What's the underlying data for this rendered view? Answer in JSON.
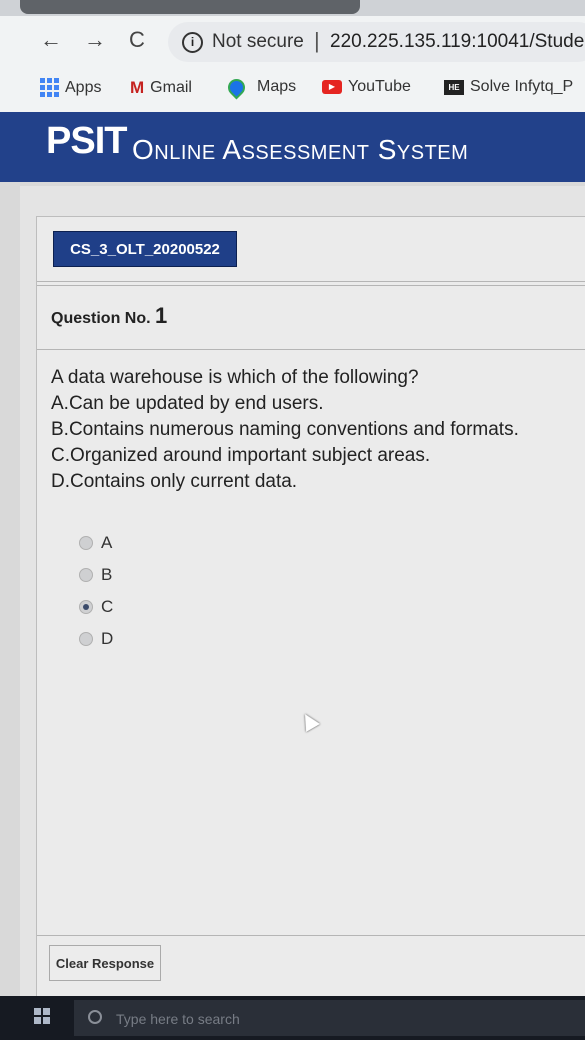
{
  "browser": {
    "security_label": "Not secure",
    "separator": "|",
    "url": "220.225.135.119:10041/Stude",
    "nav": {
      "back": "←",
      "forward": "→",
      "reload": "C"
    }
  },
  "bookmarks": {
    "items": [
      {
        "label": "Apps",
        "icon": "apps-grid-icon"
      },
      {
        "label": "Gmail",
        "icon": "gmail-icon"
      },
      {
        "label": "Maps",
        "icon": "maps-pin-icon"
      },
      {
        "label": "YouTube",
        "icon": "youtube-icon"
      },
      {
        "label": "Solve Infytq_P",
        "icon": "hackerearth-icon",
        "icon_text": "HE"
      }
    ]
  },
  "header": {
    "brand": "PSIT",
    "subtitle": "Online Assessment System",
    "color": "#22418a"
  },
  "exam": {
    "code": "CS_3_OLT_20200522",
    "question_label": "Question No.",
    "question_number": "1",
    "question_lines": [
      "A data warehouse is which of the following?",
      "A.Can be updated by end users.",
      "B.Contains numerous naming conventions and formats.",
      "C.Organized around important subject areas.",
      "D.Contains only current data."
    ],
    "options": [
      {
        "label": "A",
        "selected": false
      },
      {
        "label": "B",
        "selected": false
      },
      {
        "label": "C",
        "selected": true
      },
      {
        "label": "D",
        "selected": false
      }
    ],
    "clear_button": "Clear Response"
  },
  "taskbar": {
    "search_placeholder": "Type here to search"
  }
}
